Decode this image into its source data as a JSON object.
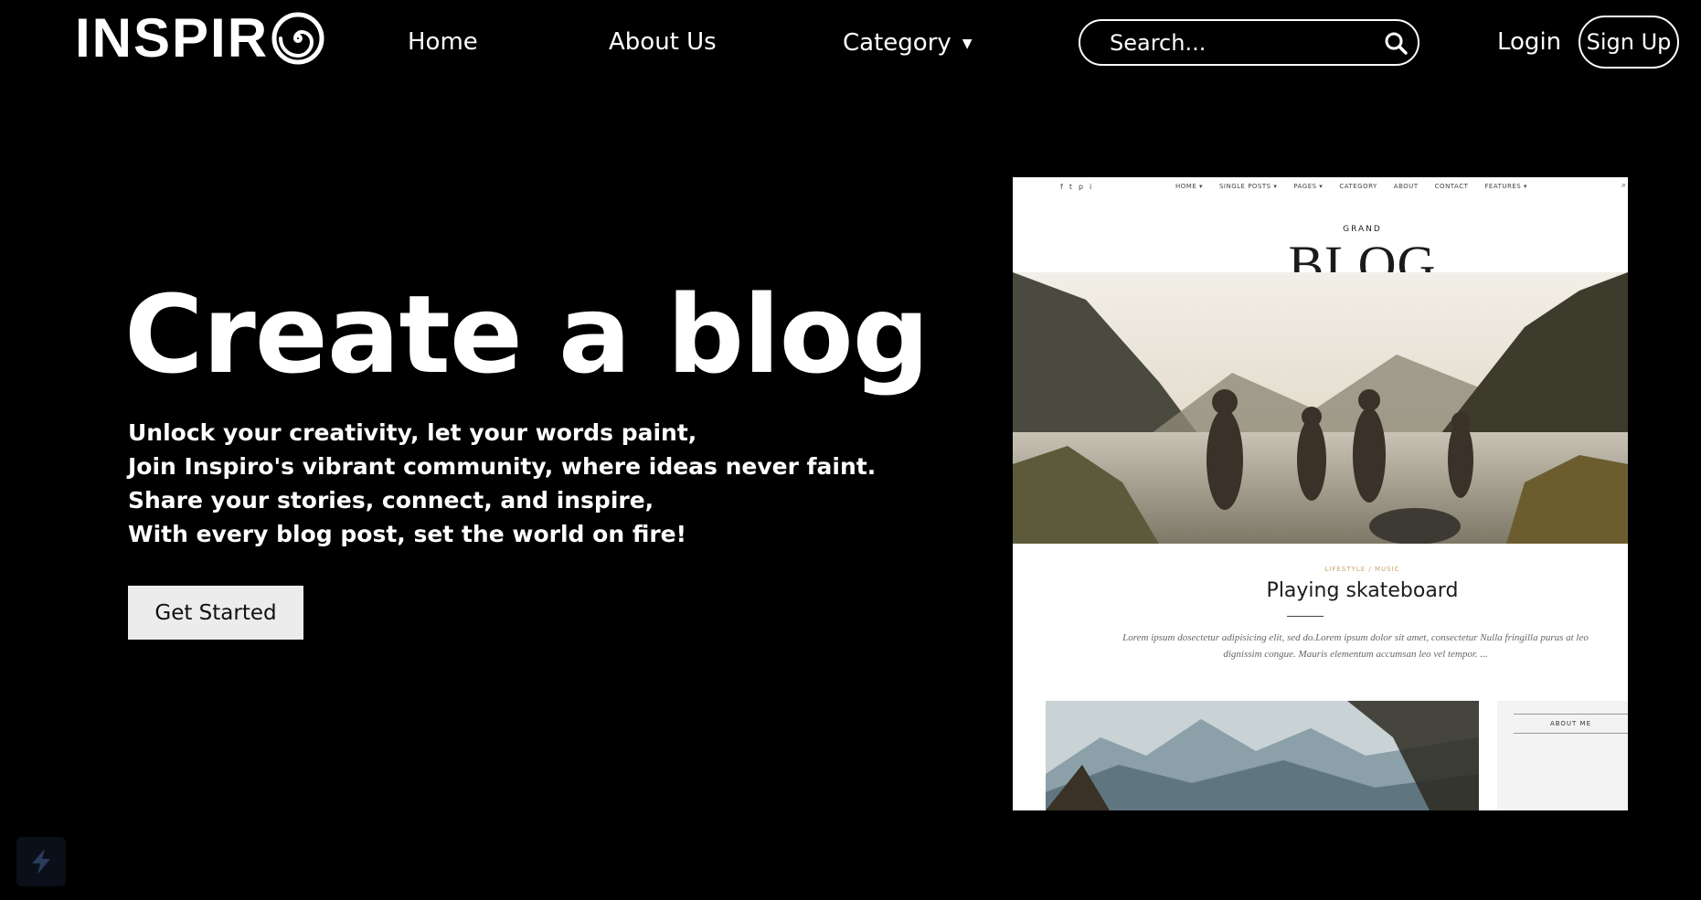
{
  "brand": {
    "name": "INSPIR",
    "logo_icon": "spiral-o-icon"
  },
  "nav": {
    "home": "Home",
    "about": "About Us",
    "category": "Category",
    "category_caret": "▼"
  },
  "search": {
    "placeholder": "Search...",
    "icon": "search-icon"
  },
  "auth": {
    "login": "Login",
    "signup": "Sign Up"
  },
  "hero": {
    "title": "Create a blog",
    "lines": [
      "Unlock your creativity, let your words paint,",
      "Join Inspiro's vibrant community, where ideas never faint.",
      "Share your stories, connect, and inspire,",
      "With every blog post, set the world on fire!"
    ],
    "cta": "Get Started"
  },
  "preview": {
    "social": [
      "f",
      "t",
      "p",
      "i"
    ],
    "menu": [
      "HOME ▾",
      "SINGLE POSTS ▾",
      "PAGES ▾",
      "CATEGORY",
      "ABOUT",
      "CONTACT",
      "FEATURES ▾"
    ],
    "kicker": "GRAND",
    "brand": "BLOG",
    "meta": "LIFESTYLE / MUSIC",
    "post_title": "Playing skateboard",
    "excerpt": "Lorem ipsum dosectetur adipisicing elit, sed do.Lorem ipsum dolor sit amet, consectetur Nulla fringilla purus at leo dignissim congue. Mauris elementum accumsan leo vel tempor. ...",
    "side_title": "ABOUT ME"
  },
  "colors": {
    "background": "#000000",
    "cta_bg": "#ececec",
    "accent_meta": "#c9a36a"
  }
}
